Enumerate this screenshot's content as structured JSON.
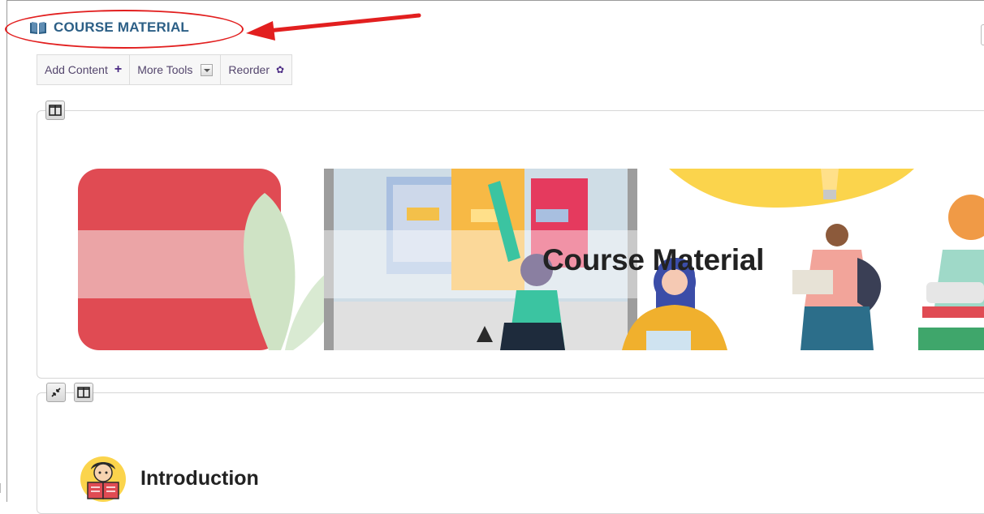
{
  "course": {
    "title": "COURSE MATERIAL",
    "title_color": "#2c5f86",
    "icon": "open-book-icon"
  },
  "annotation": {
    "color": "#e21f1f",
    "shapes": [
      "circle-highlight",
      "arrow"
    ]
  },
  "toolbar": {
    "add_content_label": "Add Content",
    "add_content_icon": "plus-icon",
    "more_tools_label": "More Tools",
    "more_tools_icon": "dropdown-arrow-icon",
    "reorder_label": "Reorder",
    "reorder_icon": "gear-icon",
    "accent": "#4b2b84"
  },
  "panels": [
    {
      "controls": [
        "split-view-icon"
      ],
      "banner_title": "Course Material"
    },
    {
      "controls": [
        "collapse-icon",
        "split-view-icon"
      ],
      "section_title": "Introduction",
      "section_icon": "student-reading-icon"
    }
  ],
  "colors": {
    "banner_red": "#e04b53",
    "banner_yellow": "#fbd44c",
    "book_pink": "#e53a5e",
    "book_blue": "#a8bfe0"
  }
}
